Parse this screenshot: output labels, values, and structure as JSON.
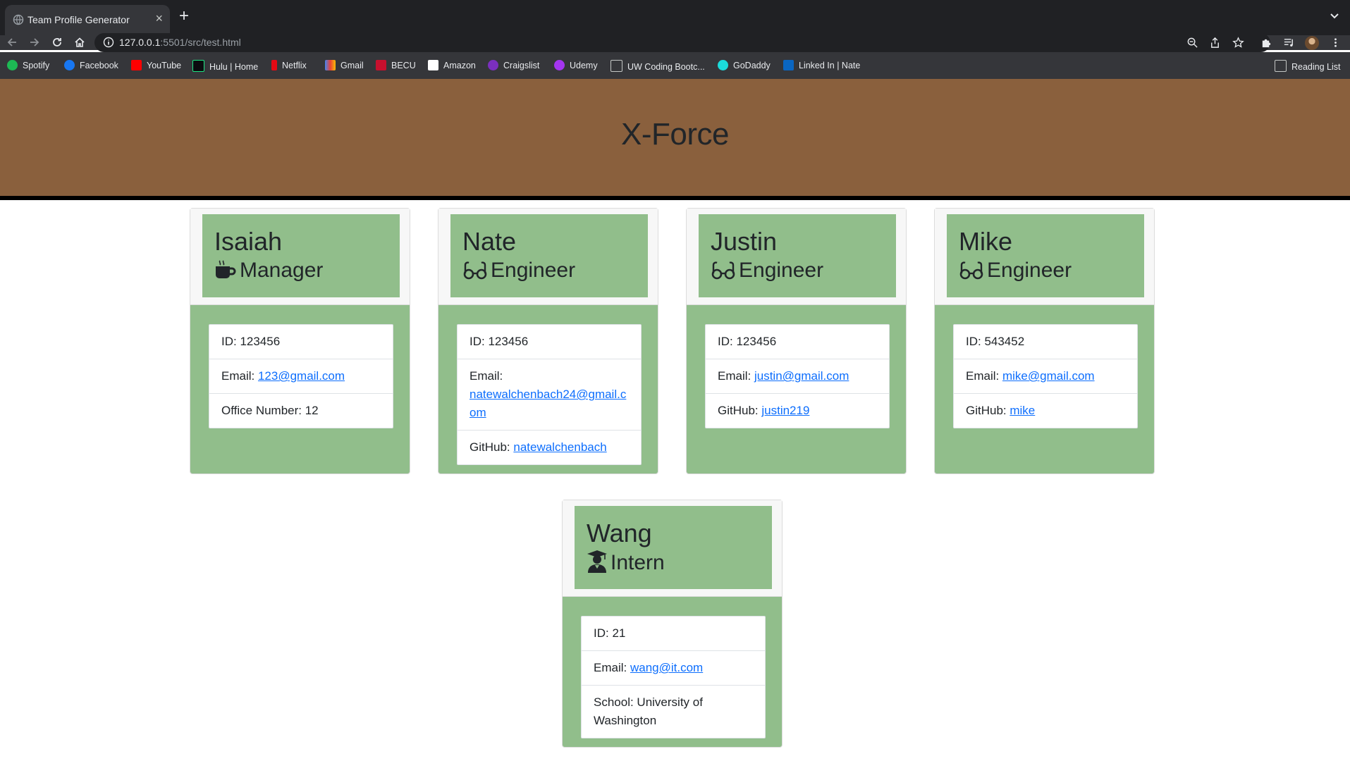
{
  "browser": {
    "tab_title": "Team Profile Generator",
    "url_host": "127.0.0.1",
    "url_rest": ":5501/src/test.html",
    "bookmarks": [
      "Spotify",
      "Facebook",
      "YouTube",
      "Hulu | Home",
      "Netflix",
      "Gmail",
      "BECU",
      "Amazon",
      "Craigslist",
      "Udemy",
      "UW Coding Bootc...",
      "GoDaddy",
      "Linked In | Nate"
    ],
    "reading_list": "Reading List"
  },
  "page": {
    "team_name": "X-Force"
  },
  "team": [
    {
      "name": "Isaiah",
      "role": "Manager",
      "role_icon": "mug-icon",
      "id_text": "ID: 123456",
      "email_label": "Email: ",
      "email": "123@gmail.com",
      "extra_label": "Office Number: 12",
      "extra_link": ""
    },
    {
      "name": "Nate",
      "role": "Engineer",
      "role_icon": "glasses-icon",
      "id_text": "ID: 123456",
      "email_label": "Email: ",
      "email": "natewalchenbach24@gmail.com",
      "extra_label": "GitHub: ",
      "extra_link": "natewalchenbach"
    },
    {
      "name": "Justin",
      "role": "Engineer",
      "role_icon": "glasses-icon",
      "id_text": "ID: 123456",
      "email_label": "Email: ",
      "email": "justin@gmail.com",
      "extra_label": "GitHub: ",
      "extra_link": "justin219"
    },
    {
      "name": "Mike",
      "role": "Engineer",
      "role_icon": "glasses-icon",
      "id_text": "ID: 543452",
      "email_label": "Email: ",
      "email": "mike@gmail.com",
      "extra_label": "GitHub: ",
      "extra_link": "mike"
    },
    {
      "name": "Wang",
      "role": "Intern",
      "role_icon": "graduate-icon",
      "id_text": "ID: 21",
      "email_label": "Email: ",
      "email": "wang@it.com",
      "extra_label": "School: University of Washington",
      "extra_link": ""
    }
  ],
  "colors": {
    "header_brown": "#8a603d",
    "card_green": "#91be8b",
    "link_blue": "#0d6efd"
  }
}
